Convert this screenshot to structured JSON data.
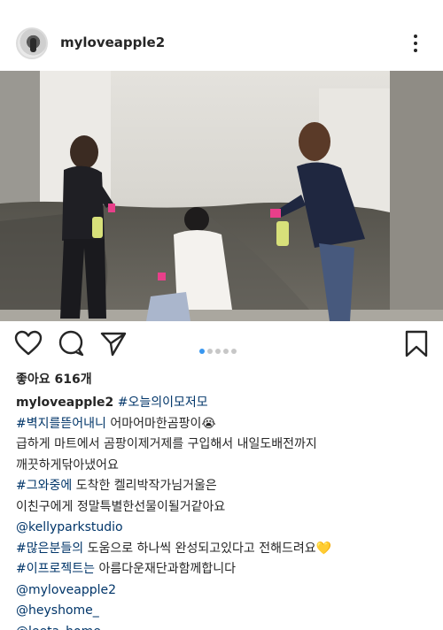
{
  "post": {
    "username": "myloveapple2",
    "likes_label": "좋아요 616개",
    "carousel": {
      "count": 5,
      "active_index": 0
    }
  },
  "colors": {
    "text": "#262626",
    "link": "#003569",
    "carousel_active": "#3897f0",
    "carousel_inactive": "#c7c7c7"
  },
  "icons": {
    "more": "more-options-icon",
    "like": "heart-icon",
    "comment": "comment-icon",
    "share": "send-icon",
    "save": "bookmark-icon"
  },
  "caption": {
    "line1": {
      "username": "myloveapple2",
      "hashtag": "#오늘의이모저모"
    },
    "line2": {
      "hashtag": "#벽지를뜯어내니",
      "text": " 어마어마한곰팡이😭"
    },
    "line3": "급하게 마트에서 곰팡이제거제를 구입해서 내일도배전까지",
    "line4": "깨끗하게닦아냈어요",
    "line5": {
      "hashtag": "#그와중에",
      "text": " 도착한 켈리박작가님거울은"
    },
    "line6": "이친구에게 정말특별한선물이될거같아요",
    "line7": "@kellyparkstudio",
    "line8": {
      "hashtag": "#많은분들의",
      "text": " 도움으로 하나씩 완성되고있다고 전해드려요💛"
    },
    "line9": {
      "hashtag": "#이프로젝트는",
      "text": " 아름다운재단과함께합니다"
    },
    "line10": "@myloveapple2",
    "line11": "@heyshome_",
    "line12": "@leeta_home"
  }
}
